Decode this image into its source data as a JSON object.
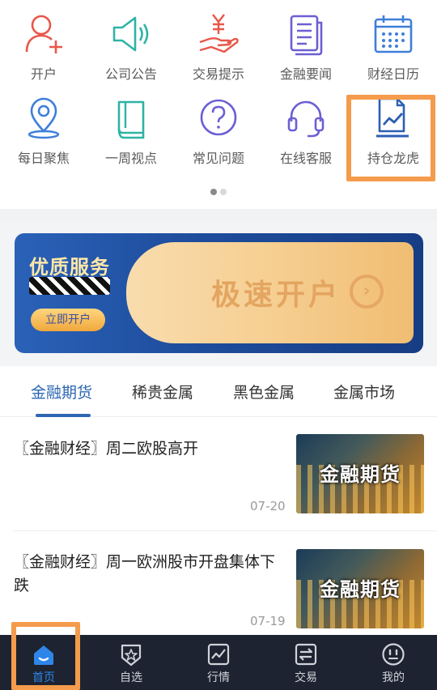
{
  "icons": {
    "items": [
      {
        "label": "开户",
        "icon": "user-add-icon",
        "color": "#e8574a"
      },
      {
        "label": "公司公告",
        "icon": "megaphone-icon",
        "color": "#2fb3a5"
      },
      {
        "label": "交易提示",
        "icon": "money-hand-icon",
        "color": "#e8574a"
      },
      {
        "label": "金融要闻",
        "icon": "news-doc-icon",
        "color": "#6b5fd3"
      },
      {
        "label": "财经日历",
        "icon": "calendar-icon",
        "color": "#3e7fd9"
      },
      {
        "label": "每日聚焦",
        "icon": "location-pin-icon",
        "color": "#3e7fd9"
      },
      {
        "label": "一周视点",
        "icon": "book-icon",
        "color": "#2fb3a5"
      },
      {
        "label": "常见问题",
        "icon": "question-icon",
        "color": "#6b5fd3"
      },
      {
        "label": "在线客服",
        "icon": "headset-icon",
        "color": "#6b5fd3"
      },
      {
        "label": "持仓龙虎",
        "icon": "chart-doc-icon",
        "color": "#2c5fb4"
      }
    ],
    "page_indicator": {
      "count": 2,
      "active": 1
    }
  },
  "banner": {
    "title": "优质服务",
    "button_label": "立即开户",
    "main_text": "极速开户"
  },
  "tabs": {
    "items": [
      "金融期货",
      "稀贵金属",
      "黑色金属",
      "金属市场"
    ],
    "active": "金融期货",
    "accent": "#2c67b2"
  },
  "news": [
    {
      "title": "〖金融财经〗周二欧股高开",
      "date": "07-20",
      "thumb_text": "金融期货"
    },
    {
      "title": "〖金融财经〗周一欧洲股市开盘集体下跌",
      "date": "07-19",
      "thumb_text": "金融期货"
    }
  ],
  "bottom_nav": {
    "items": [
      {
        "label": "首页",
        "icon": "home-icon"
      },
      {
        "label": "自选",
        "icon": "star-shield-icon"
      },
      {
        "label": "行情",
        "icon": "market-chart-icon"
      },
      {
        "label": "交易",
        "icon": "exchange-icon"
      },
      {
        "label": "我的",
        "icon": "profile-face-icon"
      }
    ],
    "active": "首页",
    "active_color": "#2f86e9"
  },
  "highlight_color": "#f59b4c"
}
